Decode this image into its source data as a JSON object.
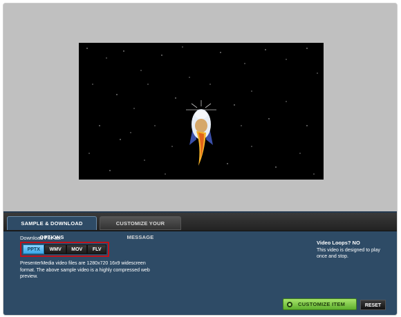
{
  "tabs": {
    "sample_download": "SAMPLE & DOWNLOAD OPTIONS",
    "customize_message": "CUSTOMIZE YOUR MESSAGE"
  },
  "download": {
    "label": "Download File as:",
    "formats": [
      "PPTX",
      "WMV",
      "MOV",
      "FLV"
    ],
    "selected": "PPTX"
  },
  "description": "PresenterMedia video files are 1280x720 16x9 widescreen format. The above sample video is a highly compressed web preview.",
  "video_loops": {
    "title_prefix": "Video Loops? ",
    "title_value": "NO",
    "note": "This video is designed to play once and stop."
  },
  "buttons": {
    "customize": "CUSTOMIZE ITEM",
    "reset": "RESET"
  },
  "preview": {
    "icon": "rocket-launch-animation"
  },
  "colors": {
    "panel": "#2e4b66",
    "active_format": "#38a7e8",
    "highlight_border": "#c0121a",
    "customize_button": "#5fb02e"
  }
}
